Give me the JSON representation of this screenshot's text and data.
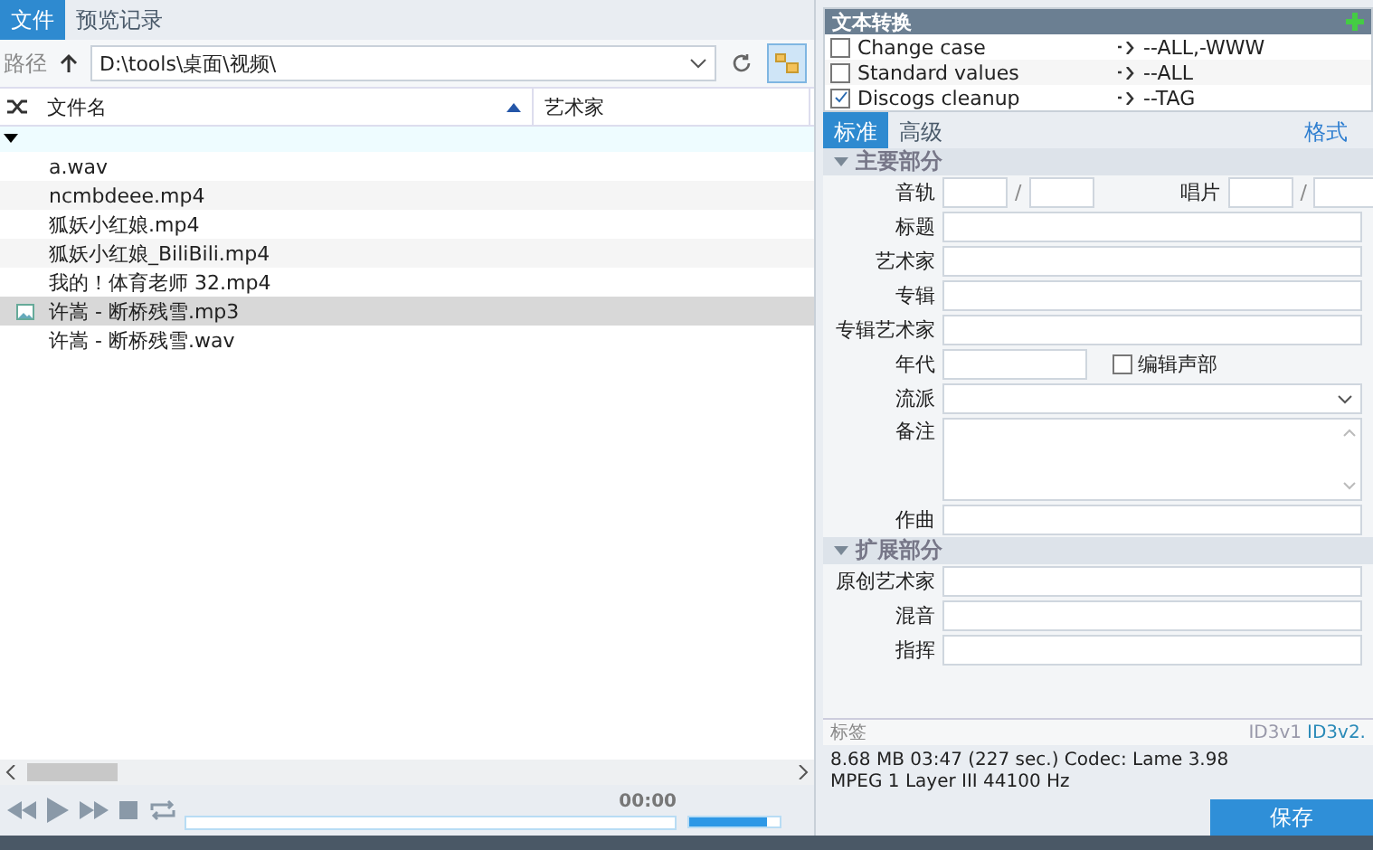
{
  "left_tabs": [
    {
      "label": "文件",
      "selected": true
    },
    {
      "label": "预览记录",
      "selected": false
    }
  ],
  "path_bar": {
    "label": "路径",
    "value": "D:\\tools\\桌面\\视频\\"
  },
  "file_table": {
    "columns": [
      "文件名",
      "艺术家"
    ],
    "rows": [
      {
        "name": "a.wav",
        "selected": false,
        "has_cover": false
      },
      {
        "name": "ncmbdeee.mp4",
        "selected": false,
        "has_cover": false
      },
      {
        "name": "狐妖小红娘.mp4",
        "selected": false,
        "has_cover": false
      },
      {
        "name": "狐妖小红娘_BiliBili.mp4",
        "selected": false,
        "has_cover": false
      },
      {
        "name": "我的！体育老师 32.mp4",
        "selected": false,
        "has_cover": false
      },
      {
        "name": "许嵩 - 断桥残雪.mp3",
        "selected": true,
        "has_cover": true
      },
      {
        "name": "许嵩 - 断桥残雪.wav",
        "selected": false,
        "has_cover": false
      }
    ]
  },
  "player": {
    "time": "00:00",
    "level": 0.85
  },
  "text_conversion": {
    "title": "文本转换",
    "items": [
      {
        "label": "Change case",
        "checked": false,
        "value": "--ALL,-WWW"
      },
      {
        "label": "Standard values",
        "checked": false,
        "value": "--ALL"
      },
      {
        "label": "Discogs cleanup",
        "checked": true,
        "value": "--TAG"
      }
    ]
  },
  "tag_tabs": [
    {
      "label": "标准",
      "selected": true
    },
    {
      "label": "高级",
      "selected": false
    }
  ],
  "format_link": "格式",
  "sections": [
    {
      "title": "主要部分",
      "fields": [
        {
          "kind": "pair",
          "label": "音轨",
          "label2": "唱片",
          "separator": "/",
          "separator2": "/"
        },
        {
          "kind": "text",
          "label": "标题"
        },
        {
          "kind": "text",
          "label": "艺术家"
        },
        {
          "kind": "text",
          "label": "专辑"
        },
        {
          "kind": "text",
          "label": "专辑艺术家"
        },
        {
          "kind": "year",
          "label": "年代",
          "check_label": "编辑声部",
          "checked": false
        },
        {
          "kind": "select",
          "label": "流派"
        },
        {
          "kind": "memo",
          "label": "备注"
        },
        {
          "kind": "text",
          "label": "作曲"
        }
      ]
    },
    {
      "title": "扩展部分",
      "fields": [
        {
          "kind": "text",
          "label": "原创艺术家"
        },
        {
          "kind": "text",
          "label": "混音"
        },
        {
          "kind": "text",
          "label": "指挥"
        }
      ]
    }
  ],
  "tag_footer": {
    "label": "标签",
    "versions": [
      {
        "label": "ID3v1",
        "selected": false
      },
      {
        "label": "ID3v2.",
        "selected": true
      }
    ]
  },
  "file_info": [
    "8.68 MB  03:47 (227 sec.)  Codec: Lame 3.98",
    "MPEG 1 Layer III  44100 Hz"
  ],
  "save_button": "保存"
}
